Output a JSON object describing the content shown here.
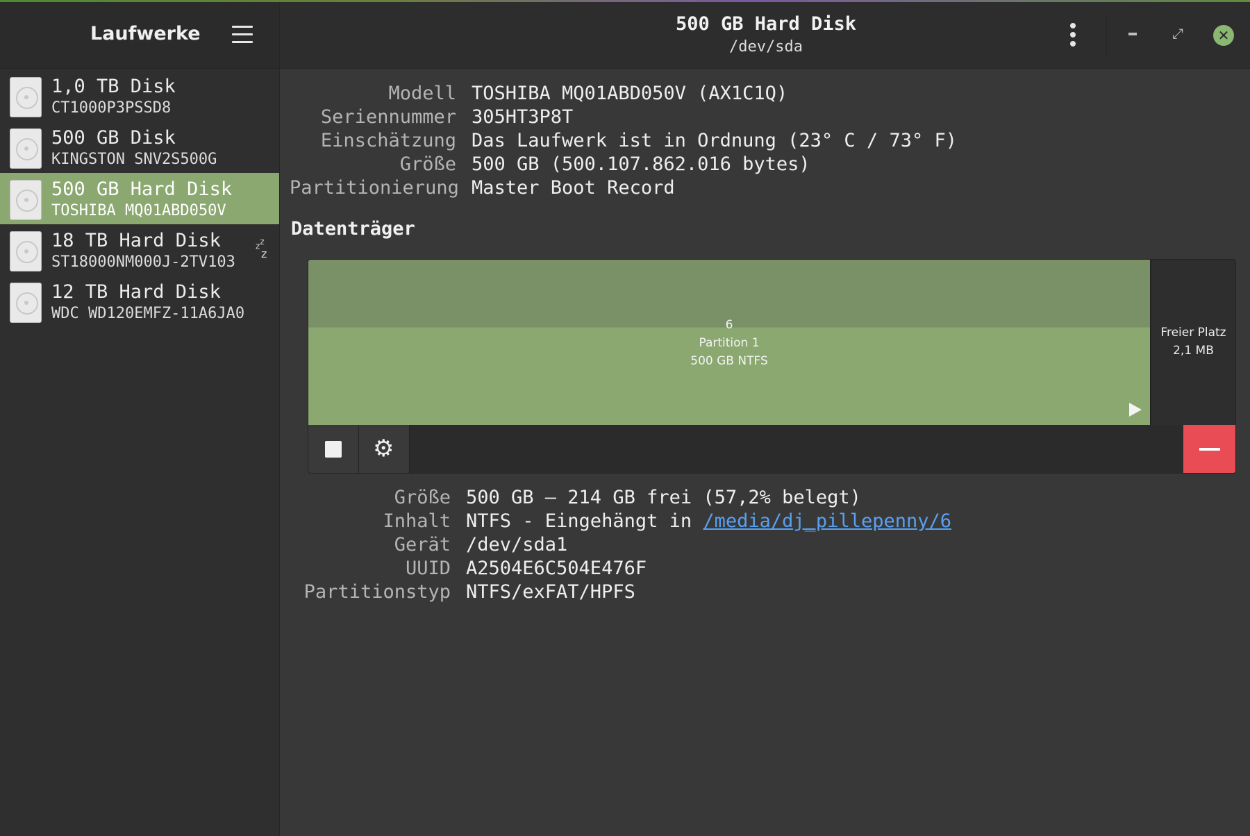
{
  "sidebar": {
    "title": "Laufwerke",
    "drives": [
      {
        "name": "1,0 TB Disk",
        "model": "CT1000P3PSSD8"
      },
      {
        "name": "500 GB Disk",
        "model": "KINGSTON SNV2S500G"
      },
      {
        "name": "500 GB Hard Disk",
        "model": "TOSHIBA MQ01ABD050V"
      },
      {
        "name": "18 TB Hard Disk",
        "model": "ST18000NM000J-2TV103"
      },
      {
        "name": "12 TB Hard Disk",
        "model": "WDC WD120EMFZ-11A6JA0"
      }
    ]
  },
  "header": {
    "title": "500 GB Hard Disk",
    "subtitle": "/dev/sda"
  },
  "disk_info": {
    "model_label": "Modell",
    "model_value": "TOSHIBA MQ01ABD050V (AX1C1Q)",
    "serial_label": "Seriennummer",
    "serial_value": "305HT3P8T",
    "assessment_label": "Einschätzung",
    "assessment_value": "Das Laufwerk ist in Ordnung (23° C / 73° F)",
    "size_label": "Größe",
    "size_value": "500 GB (500.107.862.016 bytes)",
    "partitioning_label": "Partitionierung",
    "partitioning_value": "Master Boot Record"
  },
  "volumes": {
    "section_title": "Datenträger",
    "partition": {
      "number": "6",
      "name": "Partition 1",
      "desc": "500 GB NTFS"
    },
    "free_space": {
      "label": "Freier Platz",
      "size": "2,1 MB"
    }
  },
  "volume_info": {
    "size_label": "Größe",
    "size_value": "500 GB — 214 GB frei (57,2% belegt)",
    "content_label": "Inhalt",
    "content_prefix": "NTFS - Eingehängt in",
    "content_link": "/media/dj_pillepenny/6",
    "device_label": "Gerät",
    "device_value": "/dev/sda1",
    "uuid_label": "UUID",
    "uuid_value": "A2504E6C504E476F",
    "parttype_label": "Partitionstyp",
    "parttype_value": "NTFS/exFAT/HPFS"
  },
  "colors": {
    "accent": "#8aa870",
    "delete": "#ea4c56",
    "link": "#5aa0f0"
  }
}
